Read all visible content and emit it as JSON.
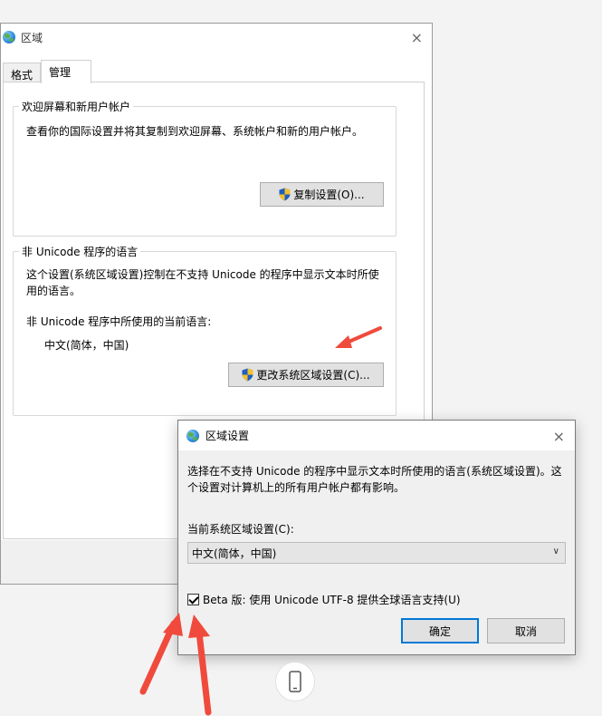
{
  "main_window": {
    "title": "区域",
    "close": "×",
    "tabs": [
      {
        "label": "格式",
        "active": false
      },
      {
        "label": "管理",
        "active": true
      }
    ],
    "welcome_group": {
      "title": "欢迎屏幕和新用户帐户",
      "description": "查看你的国际设置并将其复制到欢迎屏幕、系统帐户和新的用户帐户。",
      "copy_button": "复制设置(O)..."
    },
    "unicode_group": {
      "title": "非 Unicode 程序的语言",
      "description_line1": "这个设置(系统区域设置)控制在不支持 Unicode 的程序中显示文本时所使",
      "description_line2": "用的语言。",
      "current_label": "非 Unicode 程序中所使用的当前语言:",
      "current_value": "中文(简体，中国)",
      "change_button": "更改系统区域设置(C)..."
    }
  },
  "dialog": {
    "title": "区域设置",
    "close": "×",
    "description_line1": "选择在不支持 Unicode 的程序中显示文本时所使用的语言(系统区域设置)。这",
    "description_line2": "个设置对计算机上的所有用户帐户都有影响。",
    "current_locale_label": "当前系统区域设置(C):",
    "current_locale_value": "中文(简体，中国)",
    "beta_checkbox_label": "Beta 版: 使用 Unicode UTF-8 提供全球语言支持(U)",
    "beta_checked": true,
    "ok_button": "确定",
    "cancel_button": "取消"
  },
  "colors": {
    "annotation_arrow": "#f04a3c",
    "focus_border": "#0078d7"
  }
}
